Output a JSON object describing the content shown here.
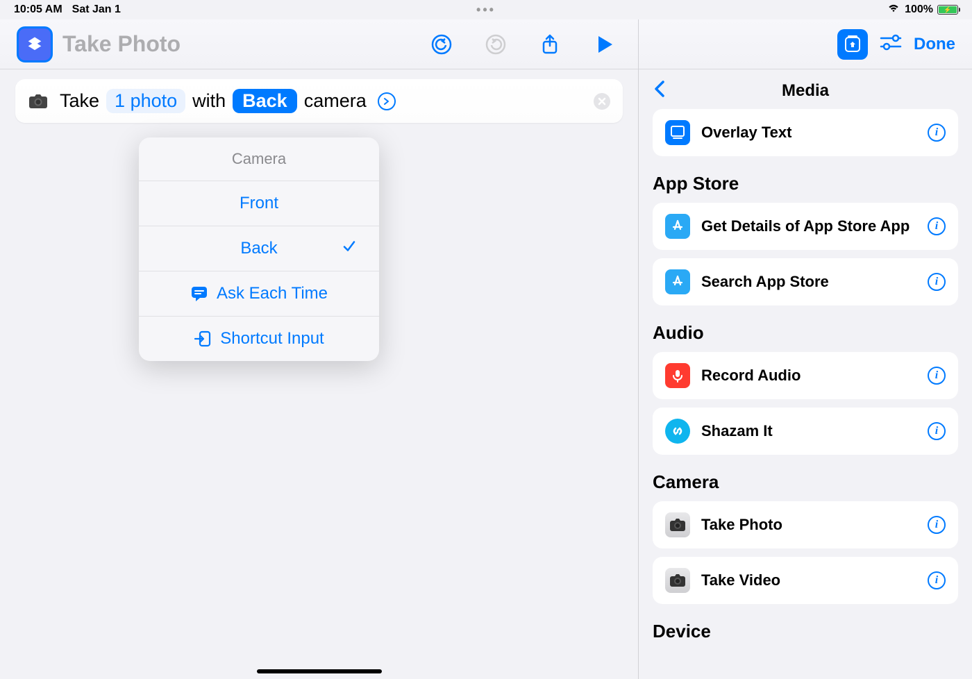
{
  "status": {
    "time": "10:05 AM",
    "date": "Sat Jan 1",
    "battery_pct": "100%"
  },
  "header": {
    "shortcut_name": "Take Photo"
  },
  "action": {
    "prefix": "Take",
    "count_param": "1 photo",
    "with": "with",
    "camera_param": "Back",
    "suffix": "camera"
  },
  "popover": {
    "title": "Camera",
    "options": [
      "Front",
      "Back"
    ],
    "selected": "Back",
    "ask_each": "Ask Each Time",
    "shortcut_input": "Shortcut Input"
  },
  "sidebar": {
    "done": "Done",
    "nav_title": "Media",
    "top_item": "Overlay Text",
    "sections": [
      {
        "title": "App Store",
        "items": [
          "Get Details of App Store App",
          "Search App Store"
        ]
      },
      {
        "title": "Audio",
        "items": [
          "Record Audio",
          "Shazam It"
        ]
      },
      {
        "title": "Camera",
        "items": [
          "Take Photo",
          "Take Video"
        ]
      },
      {
        "title": "Device",
        "items": []
      }
    ]
  }
}
